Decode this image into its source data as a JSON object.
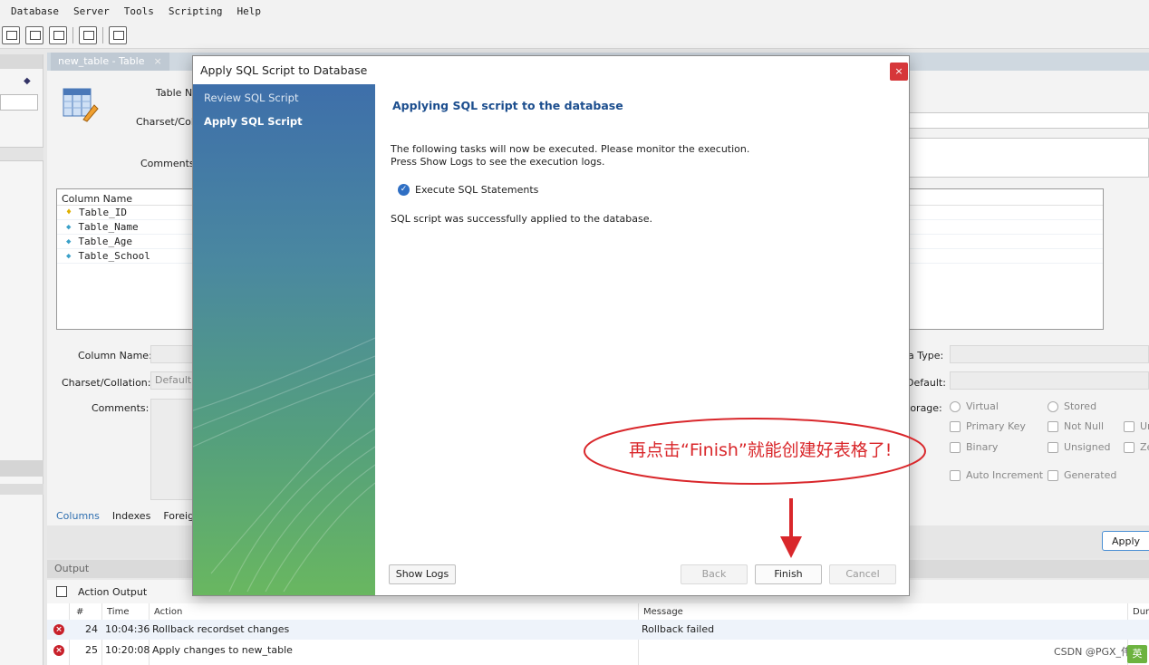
{
  "menu": [
    "Database",
    "Server",
    "Tools",
    "Scripting",
    "Help"
  ],
  "toolbar_icons": [
    "new-query-icon",
    "open-script-icon",
    "inspect-icon",
    "search-table-icon",
    "reconnect-icon"
  ],
  "tab": {
    "label": "new_table - Table",
    "close": "×"
  },
  "editor": {
    "table_name_label": "Table N",
    "charset_label": "Charset/Colla",
    "comments_label": "Comments:",
    "column_header": "Column Name",
    "columns": [
      {
        "name": "Table_ID",
        "icon": "primary-key-icon"
      },
      {
        "name": "Table_Name",
        "icon": "column-diamond-icon"
      },
      {
        "name": "Table_Age",
        "icon": "column-diamond-icon"
      },
      {
        "name": "Table_School",
        "icon": "column-diamond-icon"
      }
    ],
    "column_name_label": "Column Name:",
    "col_charset_label": "Charset/Collation:",
    "col_charset_value": "Default C",
    "col_comments_label": "Comments:",
    "data_type_label": "a Type:",
    "default_label": "Default:",
    "storage_label": "torage:",
    "storage_options": [
      "Virtual",
      "Stored"
    ],
    "flags": [
      "Primary Key",
      "Not Null",
      "Ur",
      "Binary",
      "Unsigned",
      "Ze",
      "Auto Increment",
      "Generated"
    ]
  },
  "subtabs": [
    "Columns",
    "Indexes",
    "Foreig"
  ],
  "apply_label": "Apply",
  "output": {
    "title": "Output",
    "selector": "Action Output",
    "headers": [
      "#",
      "Time",
      "Action",
      "Message",
      "Dur"
    ],
    "rows": [
      {
        "num": "24",
        "time": "10:04:36",
        "action": "Rollback recordset changes",
        "message": "Rollback failed"
      },
      {
        "num": "25",
        "time": "10:20:08",
        "action": "Apply changes to new_table",
        "message": ""
      }
    ]
  },
  "dialog": {
    "title": "Apply SQL Script to Database",
    "close": "×",
    "steps": [
      {
        "label": "Review SQL Script",
        "active": false
      },
      {
        "label": "Apply SQL Script",
        "active": true
      }
    ],
    "heading": "Applying SQL script to the database",
    "intro_line1": "The following tasks will now be executed. Please monitor the execution.",
    "intro_line2": "Press Show Logs to see the execution logs.",
    "task": "Execute SQL Statements",
    "result": "SQL script was successfully applied to the database.",
    "buttons": {
      "show_logs": "Show Logs",
      "back": "Back",
      "finish": "Finish",
      "cancel": "Cancel"
    }
  },
  "annotation": {
    "text": "再点击“Finish”就能创建好表格了!",
    "color": "#d9272b"
  },
  "watermark": "CSDN @PGX_伟",
  "ime_indicator": "英"
}
